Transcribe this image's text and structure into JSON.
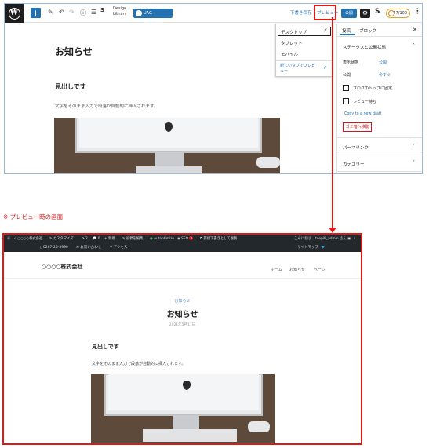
{
  "editor": {
    "toolbar": {
      "design_library": [
        "Design",
        "Library"
      ],
      "uag_templates": "UAG Templates",
      "save_draft": "下書き保存",
      "preview": "プレビュー",
      "publish": "公開",
      "seo_score": "47/100"
    },
    "post": {
      "title": "お知らせ",
      "heading": "見出しです",
      "paragraph": "文字をそのまま入力で段落が自動的に挿入されます。"
    },
    "preview_menu": {
      "items": [
        "デスクトップ",
        "タブレット",
        "モバイル"
      ],
      "selected": "デスクトップ",
      "new_tab": "新しいタブでプレビュー"
    },
    "sidebar": {
      "tabs": [
        "投稿",
        "ブロック"
      ],
      "status_section": "ステータスと公開状態",
      "visibility_label": "表示状態",
      "visibility_value": "公開",
      "publish_label": "公開",
      "publish_value": "今すぐ",
      "sticky_label": "ブログのトップに固定",
      "pending_label": "レビュー待ち",
      "copy_draft": "Copy to a new draft",
      "trash": "ゴミ箱へ移動",
      "permalink": "パーマリンク",
      "category": "カテゴリー"
    }
  },
  "caption": "※ プレビュー時の画面",
  "preview": {
    "adminbar": {
      "site": "○○○○株式会社",
      "customize": "カスタマイズ",
      "updates": "2",
      "comments": "0",
      "new": "新規",
      "edit": "投稿を編集",
      "autoptimize": "Autoptimize",
      "seo": "SEO",
      "seo_badge": "3",
      "draft": "新規下書きとして複製",
      "greeting": "こんにちは、 tonpiti_admin さん"
    },
    "topbar": {
      "phone": "0267-25-3990",
      "contact": "お問い合わせ",
      "access": "アクセス",
      "sitemap": "サイトマップ"
    },
    "header": {
      "site_name": "○○○○株式会社",
      "nav": [
        "ホーム",
        "お知らせ",
        "ページ"
      ]
    },
    "post": {
      "category": "お知らせ",
      "title": "お知らせ",
      "date": "2021年5月11日",
      "heading": "見出しです",
      "paragraph": "文字をそのまま入力で段落が自動的に挿入されます。"
    }
  }
}
